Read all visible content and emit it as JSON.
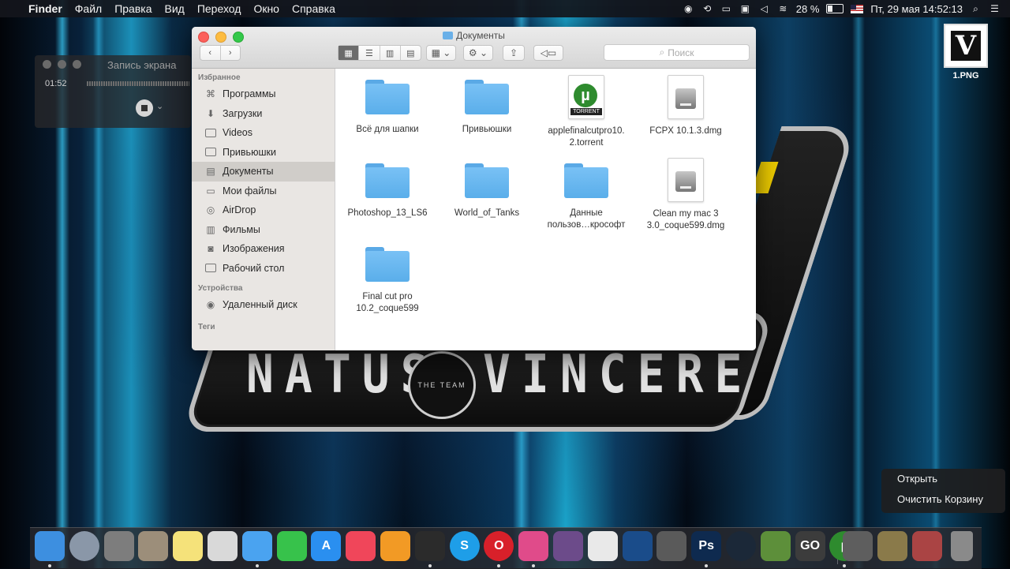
{
  "menubar": {
    "app_name": "Finder",
    "menus": [
      "Файл",
      "Правка",
      "Вид",
      "Переход",
      "Окно",
      "Справка"
    ],
    "battery": "28 %",
    "datetime": "Пт, 29 мая  14:52:13",
    "icons": [
      "apple-icon",
      "stop-record-icon",
      "sync-icon",
      "airplay-icon",
      "display-icon",
      "volume-icon",
      "wifi-icon",
      "battery-icon",
      "flag-icon",
      "spotlight-icon",
      "notifications-icon"
    ]
  },
  "desktop": {
    "file_label": "1.PNG",
    "file_thumb_letter": "V",
    "wallpaper_text": {
      "left": "NATUS",
      "right": "VINCERE",
      "circle": "THE TEAM"
    }
  },
  "recording": {
    "title": "Запись экрана",
    "time": "01:52"
  },
  "finder": {
    "title": "Документы",
    "search_placeholder": "Поиск",
    "sidebar": {
      "favorites_header": "Избранное",
      "favorites": [
        {
          "label": "Программы",
          "icon": "applications-icon"
        },
        {
          "label": "Загрузки",
          "icon": "downloads-icon"
        },
        {
          "label": "Videos",
          "icon": "folder-icon"
        },
        {
          "label": "Привьюшки",
          "icon": "folder-icon"
        },
        {
          "label": "Документы",
          "icon": "documents-icon",
          "selected": true
        },
        {
          "label": "Мои файлы",
          "icon": "all-files-icon"
        },
        {
          "label": "AirDrop",
          "icon": "airdrop-icon"
        },
        {
          "label": "Фильмы",
          "icon": "movies-icon"
        },
        {
          "label": "Изображения",
          "icon": "pictures-icon"
        },
        {
          "label": "Рабочий стол",
          "icon": "desktop-icon"
        }
      ],
      "devices_header": "Устройства",
      "devices": [
        {
          "label": "Удаленный диск",
          "icon": "remote-disc-icon"
        }
      ],
      "tags_header": "Теги"
    },
    "files": [
      {
        "name": "Всё для шапки",
        "kind": "folder"
      },
      {
        "name": "Привьюшки",
        "kind": "folder"
      },
      {
        "name": "applefinalcutpro10.\n2.torrent",
        "kind": "torrent"
      },
      {
        "name": "FCPX 10.1.3.dmg",
        "kind": "dmg"
      },
      {
        "name": "Photoshop_13_LS6",
        "kind": "folder"
      },
      {
        "name": "World_of_Tanks",
        "kind": "folder"
      },
      {
        "name": "Данные\nпользов…крософт",
        "kind": "folder"
      },
      {
        "name": "Clean my mac 3\n3.0_coque599.dmg",
        "kind": "dmg"
      },
      {
        "name": "Final cut pro\n10.2_coque599",
        "kind": "folder"
      }
    ],
    "torrent_badge": "TORRENT"
  },
  "context_menu": {
    "items": [
      "Открыть",
      "Очистить Корзину"
    ]
  },
  "dock": {
    "apps": [
      {
        "name": "finder-icon",
        "color": "#3d8fe0"
      },
      {
        "name": "launchpad-icon",
        "color": "#8a97a8"
      },
      {
        "name": "system-preferences-icon",
        "color": "#7d7d7d"
      },
      {
        "name": "calculator-icon",
        "color": "#9c8e7a"
      },
      {
        "name": "notes-icon",
        "color": "#f5e27a"
      },
      {
        "name": "preview-icon",
        "color": "#d9d9d9"
      },
      {
        "name": "messages-icon",
        "color": "#4aa3f0"
      },
      {
        "name": "facetime-icon",
        "color": "#37c24b"
      },
      {
        "name": "app-store-icon",
        "color": "#2a8ff0"
      },
      {
        "name": "itunes-icon",
        "color": "#f0465a"
      },
      {
        "name": "ibooks-icon",
        "color": "#f29a25"
      },
      {
        "name": "obs-icon",
        "color": "#2b2b2b"
      },
      {
        "name": "skype-icon",
        "color": "#1e9ee8"
      },
      {
        "name": "opera-icon",
        "color": "#d8202a"
      },
      {
        "name": "cleanmymac-icon",
        "color": "#e04b8a"
      },
      {
        "name": "photo-booth-icon",
        "color": "#6c4b8a"
      },
      {
        "name": "coffee-icon",
        "color": "#e9e9e9"
      },
      {
        "name": "quicktime-icon",
        "color": "#1a4c8a"
      },
      {
        "name": "final-cut-pro-icon",
        "color": "#5a5a5a"
      },
      {
        "name": "photoshop-icon",
        "color": "#0e2a4f"
      },
      {
        "name": "steam-icon",
        "color": "#1b2838"
      },
      {
        "name": "minecraft-icon",
        "color": "#5d8f3a"
      },
      {
        "name": "csgo-icon",
        "color": "#3c3c3c"
      },
      {
        "name": "utorrent-icon",
        "color": "#2e8b2e"
      },
      {
        "name": "recent-items-icon-1",
        "color": "#5e5e5e"
      },
      {
        "name": "recent-items-icon-2",
        "color": "#8a7a4a"
      },
      {
        "name": "recent-items-icon-3",
        "color": "#a44"
      },
      {
        "name": "trash-icon",
        "color": "#8a8a8a"
      }
    ],
    "glyphs": {
      "photoshop-icon": "Ps",
      "skype-icon": "S",
      "opera-icon": "O",
      "app-store-icon": "A",
      "utorrent-icon": "µ",
      "csgo-icon": "GO"
    }
  }
}
